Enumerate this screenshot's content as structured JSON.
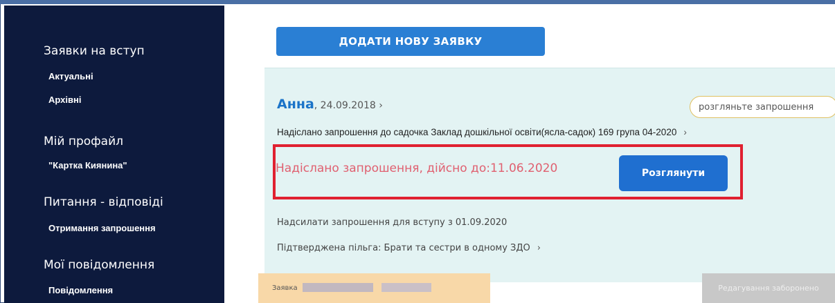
{
  "sidebar": {
    "sections": [
      {
        "title": "Заявки на вступ",
        "items": [
          "Актуальні",
          "Архівні"
        ]
      },
      {
        "title": "Мій профайл",
        "items": [
          "\"Картка Киянина\""
        ]
      },
      {
        "title": "Питання - відповіді",
        "items": [
          "Отримання запрошення"
        ]
      },
      {
        "title": "Мої повідомлення",
        "items": [
          "Повідомлення"
        ]
      }
    ]
  },
  "main": {
    "add_button_label": "ДОДАТИ НОВУ ЗАЯВКУ",
    "card": {
      "child_name": "Анна",
      "child_date": ", 24.09.2018 ›",
      "badge": "розгляньте запрошення",
      "invite_text": "Надіслано запрошення до садочка Заклад дошкільної освіти(ясла-садок) 169 група 04-2020",
      "invite_chevron": "›",
      "validity_text": "Надіслано запрошення, дійсно до:11.06.2020",
      "review_button_label": "Розглянути",
      "send_text": "Надсилати запрошення для вступу з 01.09.2020",
      "benefit_text": "Підтверджена пільга: Брати та сестри в одному ЗДО",
      "benefit_chevron": "›"
    },
    "footer": {
      "application_label": "Заявка",
      "edit_button_label": "Редагування заборонено"
    }
  },
  "colors": {
    "sidebar_bg": "#0d1a3d",
    "primary_button": "#2a7fd4",
    "card_bg": "#e3f3f3",
    "highlight_border": "#e02030",
    "validity_text": "#e06070",
    "child_name": "#1a73c8"
  }
}
